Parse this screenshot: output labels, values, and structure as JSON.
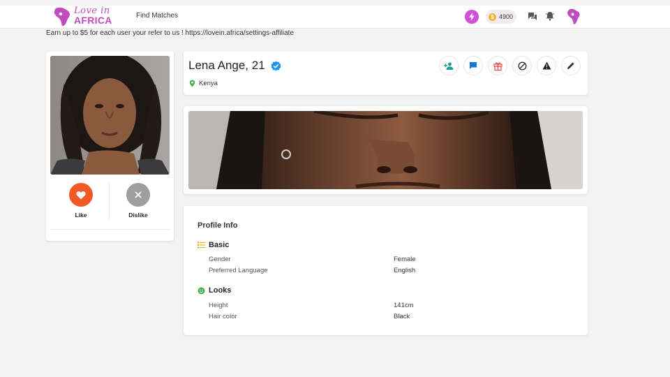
{
  "header": {
    "logo_love": "Love in",
    "logo_africa": "AFRICA",
    "nav_find": "Find Matches",
    "coins": "4900",
    "coin_symbol": "$",
    "icons": [
      "boost-icon",
      "coin-icon",
      "chat-icon",
      "bell-icon",
      "africa-avatar-icon"
    ],
    "accent": "#d24fd9"
  },
  "affiliate": {
    "text": "Earn up to $5 for each user your refer to us ! https://lovein.africa/settings-affiliate"
  },
  "profile": {
    "name": "Lena Ange, 21",
    "location": "Kenya",
    "actions": [
      "add-friend-icon",
      "message-icon",
      "gift-icon",
      "block-icon",
      "report-icon",
      "edit-icon"
    ]
  },
  "left": {
    "like_label": "Like",
    "dislike_label": "Dislike",
    "like_color": "#f15a24"
  },
  "info": {
    "title": "Profile Info",
    "sections": [
      {
        "heading": "Basic",
        "rows": [
          {
            "label": "Gender",
            "value": "Female"
          },
          {
            "label": "Preferred Language",
            "value": "English"
          }
        ]
      },
      {
        "heading": "Looks",
        "rows": [
          {
            "label": "Height",
            "value": "141cm"
          },
          {
            "label": "Hair color",
            "value": "Black"
          }
        ]
      }
    ]
  }
}
